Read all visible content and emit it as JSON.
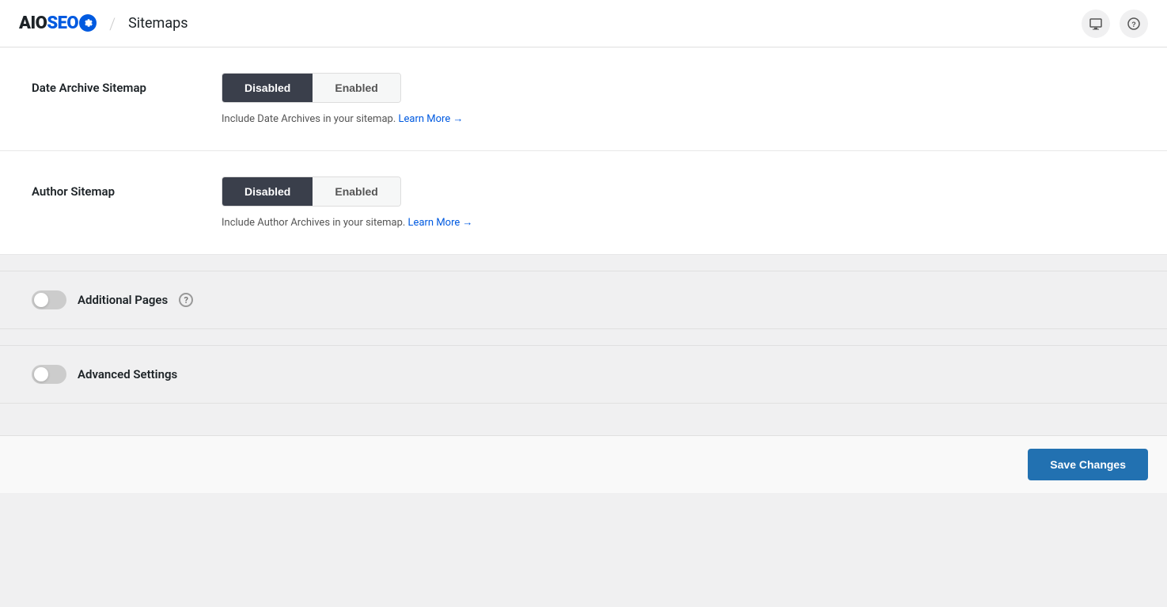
{
  "header": {
    "logo_aio": "AIO",
    "logo_seo": "SEO",
    "page_title": "Sitemaps",
    "separator": "/"
  },
  "date_archive": {
    "label": "Date Archive Sitemap",
    "disabled_btn": "Disabled",
    "enabled_btn": "Enabled",
    "description": "Include Date Archives in your sitemap.",
    "learn_more": "Learn More →",
    "active": "disabled"
  },
  "author_sitemap": {
    "label": "Author Sitemap",
    "disabled_btn": "Disabled",
    "enabled_btn": "Enabled",
    "description": "Include Author Archives in your sitemap.",
    "learn_more": "Learn More →",
    "active": "disabled"
  },
  "additional_pages": {
    "label": "Additional Pages",
    "enabled": false
  },
  "advanced_settings": {
    "label": "Advanced Settings",
    "enabled": false
  },
  "footer": {
    "save_label": "Save Changes"
  }
}
